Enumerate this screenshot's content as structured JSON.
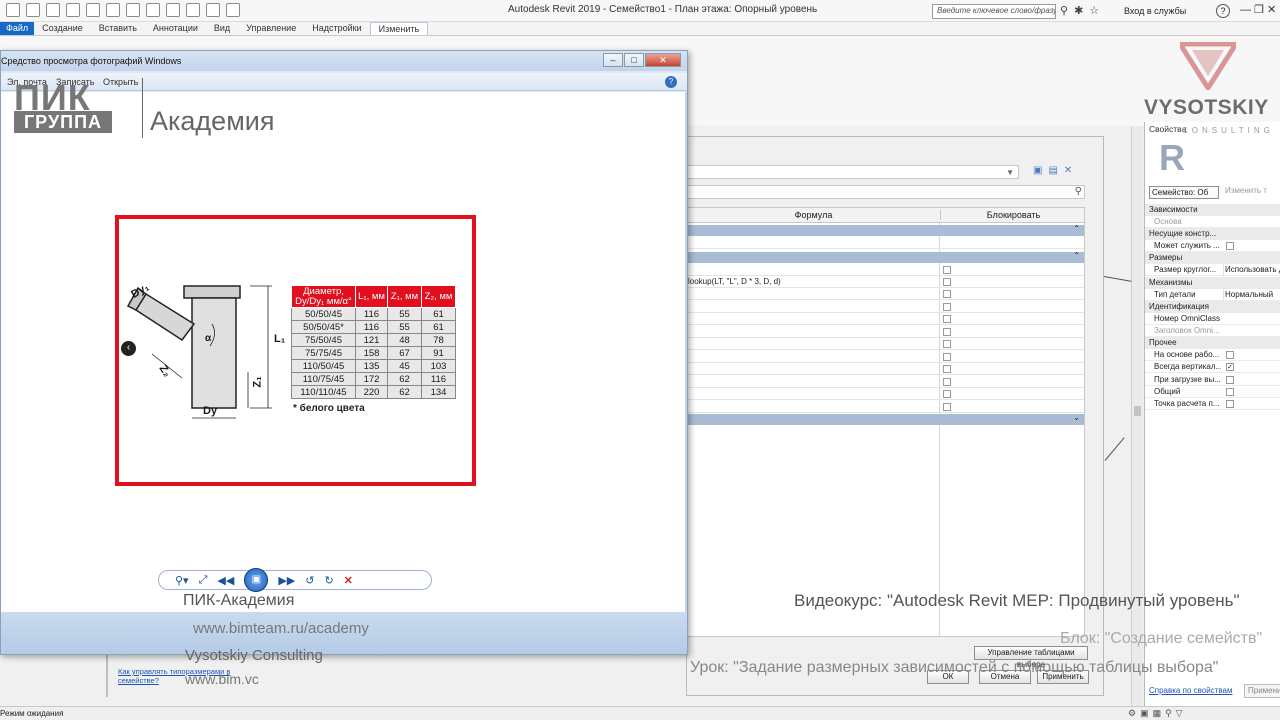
{
  "revit": {
    "title": "Autodesk Revit 2019 - Семейство1 - План этажа: Опорный уровень",
    "search_placeholder": "Введите ключевое слово/фразу",
    "login_label": "Вход в службы",
    "ribbon_tabs": {
      "file": "Файл",
      "create": "Создание",
      "insert": "Вставить",
      "annotate": "Аннотации",
      "view": "Вид",
      "manage": "Управление",
      "addins": "Надстройки",
      "modify": "Изменить"
    },
    "status_text": "Режим ожидания"
  },
  "viewer": {
    "title": "Средство просмотра фотографий Windows",
    "menu": {
      "email": "Эл. почта",
      "burn": "Записать",
      "open": "Открыть"
    }
  },
  "slide": {
    "logo_pik": "ПИК",
    "logo_group": "ГРУППА",
    "academy": "Академия",
    "table": {
      "headers": [
        "Диаметр, Dy/Dy₁ мм/α°",
        "L₁, мм",
        "Z₁, мм",
        "Z₂, мм"
      ],
      "rows": [
        [
          "50/50/45",
          "116",
          "55",
          "61"
        ],
        [
          "50/50/45*",
          "116",
          "55",
          "61"
        ],
        [
          "75/50/45",
          "121",
          "48",
          "78"
        ],
        [
          "75/75/45",
          "158",
          "67",
          "91"
        ],
        [
          "110/50/45",
          "135",
          "45",
          "103"
        ],
        [
          "110/75/45",
          "172",
          "62",
          "116"
        ],
        [
          "110/110/45",
          "220",
          "62",
          "134"
        ]
      ],
      "note": "* белого цвета"
    },
    "diagram_labels": {
      "dy1": "Dy₁",
      "dy": "Dy",
      "l1": "L₁",
      "z1": "Z₁",
      "z2": "Z₂",
      "alpha": "α"
    }
  },
  "captions": {
    "pik_academy": "ПИК-Академия",
    "site": "www.bimteam.ru/academy",
    "vysotskiy": "Vysotskiy Consulting",
    "bimvc": "www.bim.vc",
    "course": "Видеокурс: \"Autodesk Revit MEP: Продвинутый уровень\"",
    "block": "Блок: \"Создание семейств\"",
    "lesson": "Урок: \"Задание размерных зависимостей с помощью таблицы выбора\""
  },
  "types_dialog": {
    "col_formula": "Формула",
    "col_lock": "Блокировать",
    "formula_row": "lookup(LT, \"L\", D * 3, D, d)",
    "manage_lookup": "Управление таблицами выбора",
    "ok": "ОК",
    "cancel": "Отмена",
    "apply": "Применить",
    "help_link": "Как управлять типоразмерами в семействе?"
  },
  "properties": {
    "title": "Свойства",
    "family_select": "Семейство: Об",
    "edit_type": "Изменить т",
    "groups": [
      {
        "cat": "Зависимости",
        "rows": [
          {
            "k": "Основа",
            "v": "",
            "dim": true
          }
        ]
      },
      {
        "cat": "Несущие констр...",
        "rows": [
          {
            "k": "Может служить ...",
            "cb": true
          }
        ]
      },
      {
        "cat": "Размеры",
        "rows": [
          {
            "k": "Размер круглог...",
            "v": "Использовать д"
          }
        ]
      },
      {
        "cat": "Механизмы",
        "rows": [
          {
            "k": "Тип детали",
            "v": "Нормальный"
          }
        ]
      },
      {
        "cat": "Идентификация",
        "rows": [
          {
            "k": "Номер OmniClass",
            "v": ""
          },
          {
            "k": "Заголовок Omni...",
            "v": "",
            "dim": true
          }
        ]
      },
      {
        "cat": "Прочее",
        "rows": [
          {
            "k": "На основе рабо...",
            "cb": true
          },
          {
            "k": "Всегда вертикал...",
            "cb": true,
            "checked": true
          },
          {
            "k": "При загрузке вы...",
            "cb": true
          },
          {
            "k": "Общий",
            "cb": true
          },
          {
            "k": "Точка расчета п...",
            "cb": true
          }
        ]
      }
    ],
    "help_link": "Справка по свойствам",
    "apply": "Примени"
  },
  "watermark": {
    "name": "VYSOTSKIY",
    "sub": "CONSULTING",
    "logo_letter": "R"
  },
  "colors": {
    "accent_blue": "#1569c7",
    "red_frame": "#e2101e",
    "grid_group": "#a8bcd6"
  }
}
